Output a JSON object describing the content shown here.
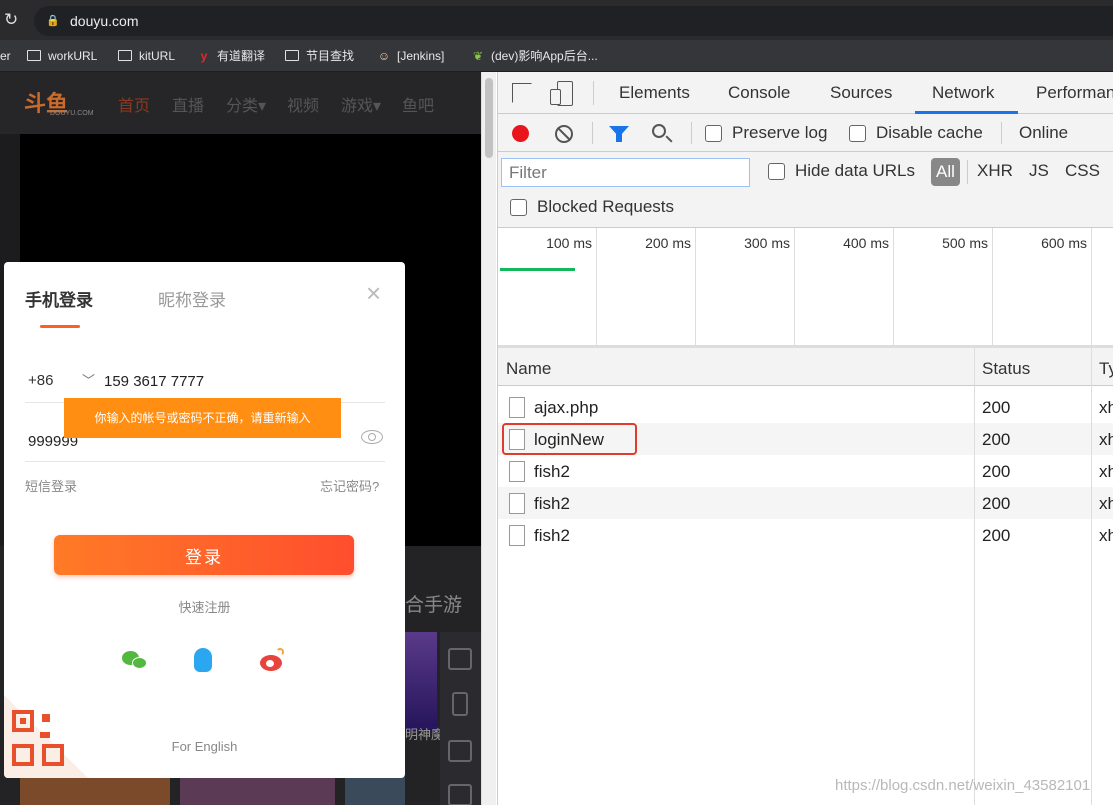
{
  "browser": {
    "url": "douyu.com",
    "bookmarks": [
      {
        "label": "er",
        "icon": "none"
      },
      {
        "label": "workURL",
        "icon": "folder-icon"
      },
      {
        "label": "kitURL",
        "icon": "folder-icon"
      },
      {
        "label": "有道翻译",
        "icon": "youdao-icon"
      },
      {
        "label": "节目查找",
        "icon": "folder-icon"
      },
      {
        "label": "[Jenkins]",
        "icon": "jenkins-icon"
      },
      {
        "label": "(dev)影响App后台...",
        "icon": "leaf-icon"
      }
    ]
  },
  "site": {
    "logo_text": "斗鱼",
    "logo_sub": "DOUYU.COM",
    "nav": [
      "首页",
      "直播",
      "分类▾",
      "视频",
      "游戏▾",
      "鱼吧"
    ],
    "section_title": "合手游",
    "thumb_caption": "明神魔"
  },
  "login": {
    "tab_phone": "手机登录",
    "tab_nickname": "昵称登录",
    "close": "×",
    "country_code": "+86",
    "phone": "159 3617 7777",
    "error_tip": "你输入的帐号或密码不正确，请重新输入",
    "password": "999999",
    "sms_login": "短信登录",
    "forgot_password": "忘记密码?",
    "login_button": "登录",
    "register": "快速注册",
    "for_english": "For English",
    "accent_color": "#ff5d23"
  },
  "devtools": {
    "tabs": [
      "Elements",
      "Console",
      "Sources",
      "Network",
      "Performan"
    ],
    "active_tab": "Network",
    "preserve_log": "Preserve log",
    "disable_cache": "Disable cache",
    "throttle": "Online",
    "filter_placeholder": "Filter",
    "hide_data_urls": "Hide data URLs",
    "type_filters": [
      "All",
      "XHR",
      "JS",
      "CSS"
    ],
    "blocked_requests": "Blocked Requests",
    "timeline_ticks": [
      "100 ms",
      "200 ms",
      "300 ms",
      "400 ms",
      "500 ms",
      "600 ms"
    ],
    "columns": [
      "Name",
      "Status",
      "Ty"
    ],
    "requests": [
      {
        "name": "ajax.php",
        "status": "200",
        "type": "xh"
      },
      {
        "name": "loginNew",
        "status": "200",
        "type": "xh",
        "highlighted": true
      },
      {
        "name": "fish2",
        "status": "200",
        "type": "xh"
      },
      {
        "name": "fish2",
        "status": "200",
        "type": "xh"
      },
      {
        "name": "fish2",
        "status": "200",
        "type": "xh"
      }
    ]
  },
  "watermark": "https://blog.csdn.net/weixin_43582101"
}
